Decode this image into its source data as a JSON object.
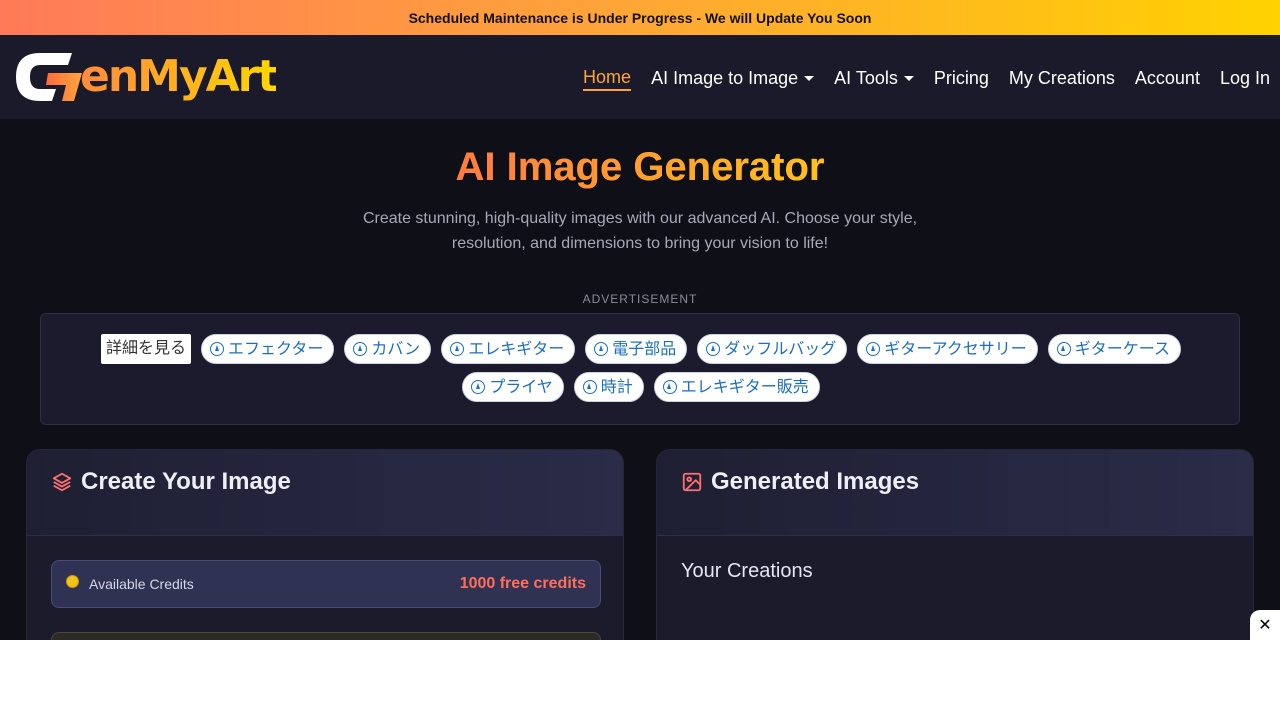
{
  "banner": {
    "text": "Scheduled Maintenance is Under Progress - We will Update You Soon"
  },
  "brand": {
    "logo_text": "enMyArt",
    "logo_letter": "G"
  },
  "nav": {
    "items": [
      {
        "label": "Home",
        "active": true,
        "dropdown": false
      },
      {
        "label": "AI Image to Image",
        "dropdown": true
      },
      {
        "label": "AI Tools",
        "dropdown": true
      },
      {
        "label": "Pricing",
        "dropdown": false
      },
      {
        "label": "My Creations",
        "dropdown": false
      },
      {
        "label": "Account",
        "dropdown": false
      },
      {
        "label": "Log In",
        "dropdown": false
      }
    ]
  },
  "hero": {
    "title": "AI Image Generator",
    "subtitle": "Create stunning, high-quality images with our advanced AI. Choose your style, resolution, and dimensions to bring your vision to life!"
  },
  "ad": {
    "label": "ADVERTISEMENT",
    "more": "詳細を見る",
    "chips_row1": [
      "エフェクター",
      "カバン",
      "エレキギター",
      "電子部品",
      "ダッフルバッグ",
      "ギターアクセサリー",
      "ギターケース"
    ],
    "chips_row2": [
      "プライヤ",
      "時計",
      "エレキギター販売"
    ]
  },
  "create_panel": {
    "title": "Create Your Image",
    "credits_label": "Available Credits",
    "credits_value": "1000 free credits"
  },
  "generated_panel": {
    "title": "Generated Images",
    "subtitle": "Your Creations"
  },
  "close": {
    "label": "✕"
  },
  "colors": {
    "accent": "#ffa53b",
    "credits": "#ff6f5a",
    "icon": "#ff6f6f"
  }
}
